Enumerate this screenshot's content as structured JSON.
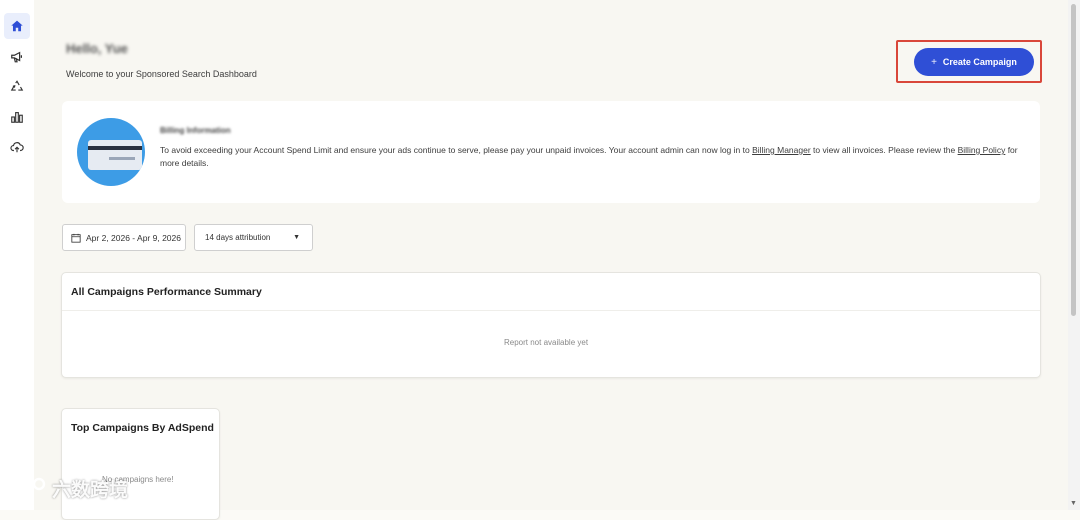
{
  "sidebar": {
    "items": [
      {
        "icon": "home-icon",
        "active": true
      },
      {
        "icon": "megaphone-icon",
        "active": false
      },
      {
        "icon": "recycle-icon",
        "active": false
      },
      {
        "icon": "bar-chart-icon",
        "active": false
      },
      {
        "icon": "cloud-upload-icon",
        "active": false
      }
    ]
  },
  "header": {
    "greeting": "Hello, Yue",
    "welcome": "Welcome to your Sponsored Search Dashboard",
    "create_button": {
      "icon": "plus-icon",
      "label": "Create Campaign",
      "color": "#2f4fd6"
    },
    "highlight_color": "#d9473a"
  },
  "billing": {
    "title": "Billing Information",
    "message_before_link1": "To avoid exceeding your Account Spend Limit and ensure your ads continue to serve, please pay your unpaid invoices. Your account admin can now log in to ",
    "link1": "Billing Manager",
    "message_between_links": " to view all invoices. Please review the ",
    "link2": "Billing Policy",
    "message_after_link2": " for more details."
  },
  "filters": {
    "date_range": "Apr 2, 2026 - Apr 9, 2026",
    "attribution": "14 days attribution"
  },
  "summary_panel": {
    "title": "All Campaigns Performance Summary",
    "empty_message": "Report not available yet"
  },
  "top_campaigns_panel": {
    "title": "Top Campaigns By AdSpend",
    "empty_message": "No campaigns here!"
  },
  "watermark": {
    "text": "六数跨境"
  }
}
